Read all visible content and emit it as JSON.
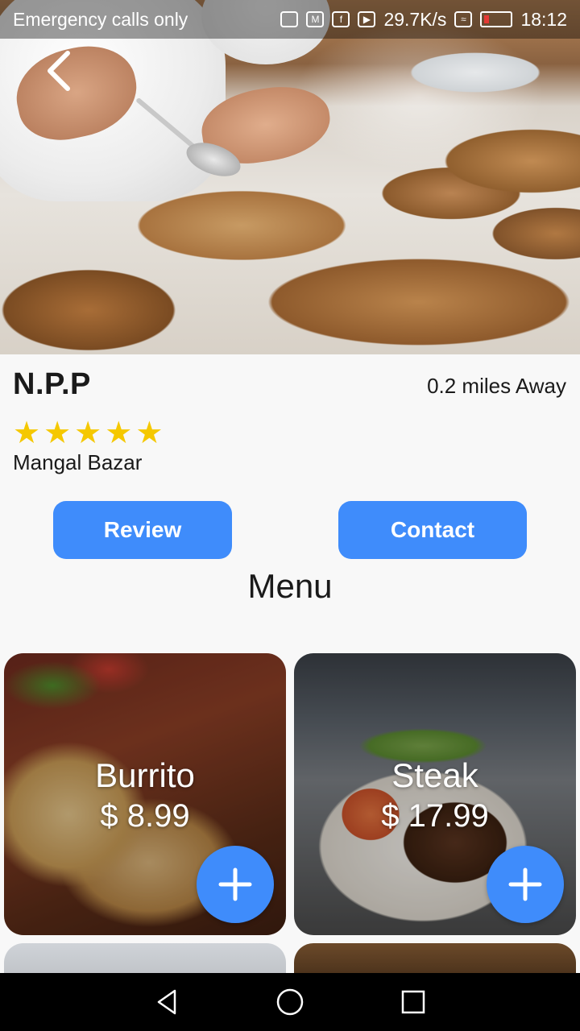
{
  "status_bar": {
    "carrier": "Emergency calls only",
    "speed": "29.7K/s",
    "time": "18:12"
  },
  "restaurant": {
    "name": "N.P.P",
    "distance": "0.2 miles Away",
    "rating": 5,
    "address": "Mangal Bazar"
  },
  "actions": {
    "review_label": "Review",
    "contact_label": "Contact"
  },
  "menu": {
    "title": "Menu",
    "items": [
      {
        "name": "Burrito",
        "price": "$ 8.99"
      },
      {
        "name": "Steak",
        "price": "$ 17.99"
      }
    ]
  },
  "colors": {
    "accent": "#3f8cfb",
    "star": "#f5c800",
    "background": "#f8f8f8"
  },
  "icons": {
    "back": "chevron-left-icon",
    "add": "plus-icon",
    "nav": [
      "back-triangle-icon",
      "home-circle-icon",
      "recents-square-icon"
    ]
  }
}
